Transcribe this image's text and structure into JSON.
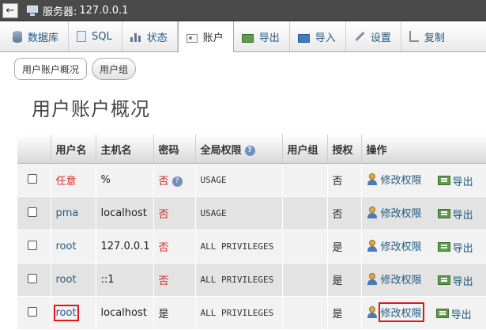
{
  "topbar": {
    "back_glyph": "←",
    "server_label": "服务器:",
    "server_value": "127.0.0.1"
  },
  "tabs": [
    {
      "label": "数据库",
      "icon": "database-icon"
    },
    {
      "label": "SQL",
      "icon": "sql-icon"
    },
    {
      "label": "状态",
      "icon": "status-icon"
    },
    {
      "label": "账户",
      "icon": "accounts-icon",
      "active": true
    },
    {
      "label": "导出",
      "icon": "export-icon"
    },
    {
      "label": "导入",
      "icon": "import-icon"
    },
    {
      "label": "设置",
      "icon": "settings-icon"
    },
    {
      "label": "复制",
      "icon": "replication-icon"
    }
  ],
  "subtabs": [
    {
      "label": "用户账户概况",
      "active": true
    },
    {
      "label": "用户组",
      "active": false
    }
  ],
  "page_title": "用户账户概况",
  "table": {
    "headers": [
      "",
      "用户名",
      "主机名",
      "密码",
      "全局权限",
      "用户组",
      "授权",
      "操作"
    ],
    "help_glyph": "?",
    "rows": [
      {
        "user": "任意",
        "host": "%",
        "password": "否",
        "privileges": "USAGE",
        "group": "",
        "grant": "否",
        "edit": "修改权限",
        "export": "导出"
      },
      {
        "user": "pma",
        "host": "localhost",
        "password": "否",
        "privileges": "USAGE",
        "group": "",
        "grant": "否",
        "edit": "修改权限",
        "export": "导出"
      },
      {
        "user": "root",
        "host": "127.0.0.1",
        "password": "否",
        "privileges": "ALL PRIVILEGES",
        "group": "",
        "grant": "是",
        "edit": "修改权限",
        "export": "导出"
      },
      {
        "user": "root",
        "host": "::1",
        "password": "否",
        "privileges": "ALL PRIVILEGES",
        "group": "",
        "grant": "是",
        "edit": "修改权限",
        "export": "导出"
      },
      {
        "user": "root",
        "host": "localhost",
        "password": "是",
        "privileges": "ALL PRIVILEGES",
        "group": "",
        "grant": "是",
        "edit": "修改权限",
        "export": "导出"
      }
    ]
  },
  "colors": {
    "link": "#235a81",
    "no": "#d12a2a",
    "highlight": "#e0161b"
  }
}
